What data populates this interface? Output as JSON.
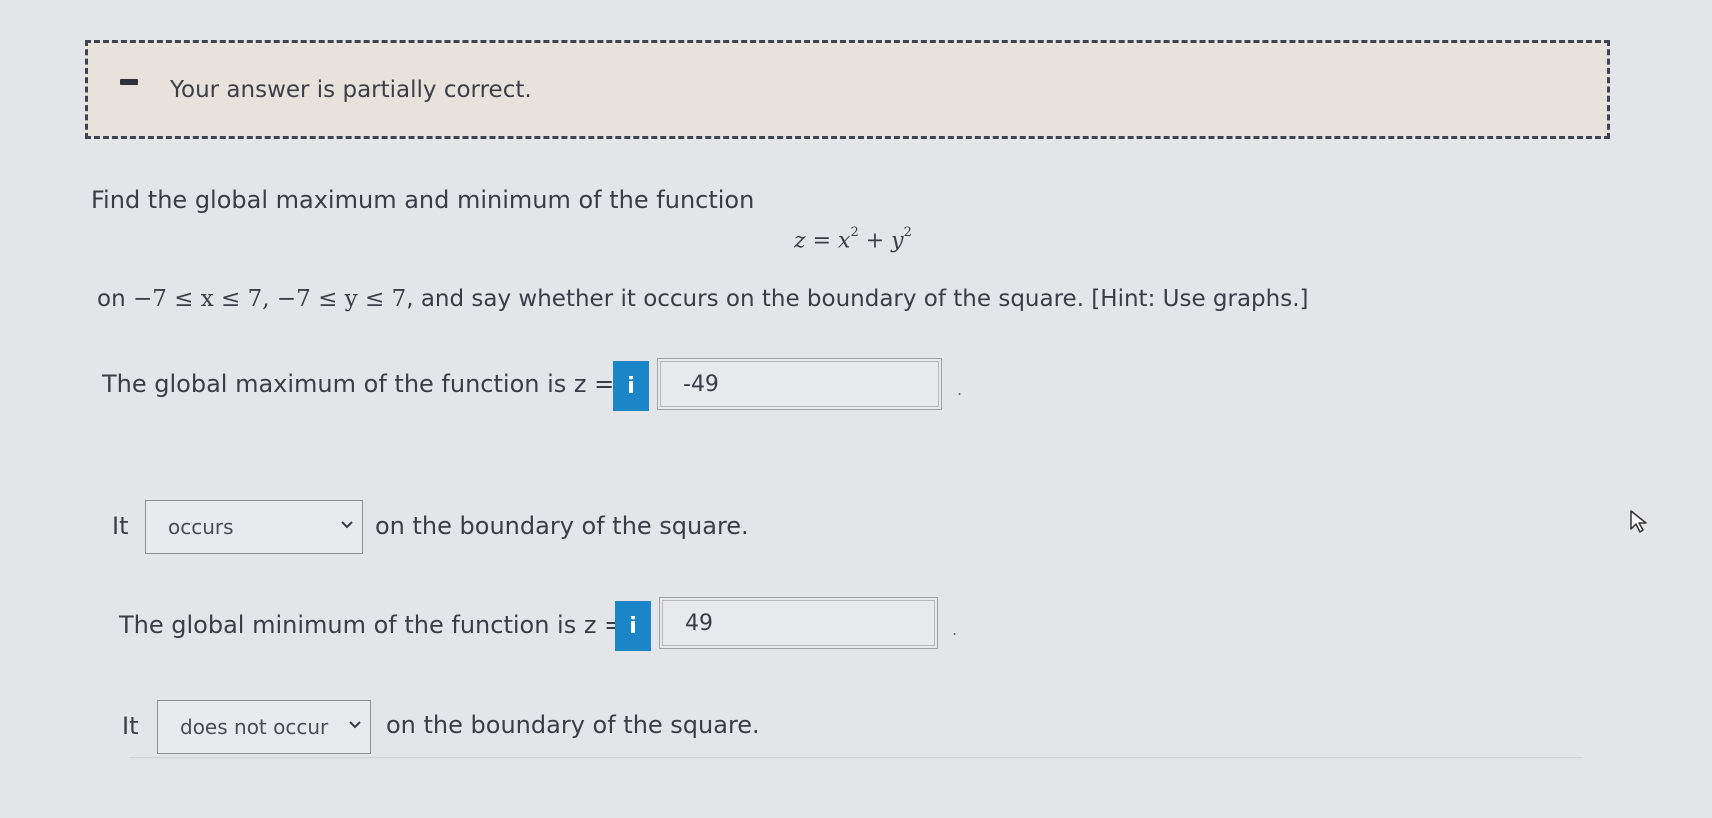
{
  "feedback": {
    "message": "Your answer is partially correct."
  },
  "problem": {
    "prompt": "Find the global maximum and minimum of the function",
    "equation": {
      "lhs": "z",
      "equals": "=",
      "term1": "x",
      "exp1": "2",
      "plus": "+",
      "term2": "y",
      "exp2": "2"
    },
    "constraint_prefix": "on ",
    "constraint_math": "−7 ≤ x ≤ 7, −7 ≤ y ≤ 7",
    "constraint_suffix": ", and say whether it occurs on the boundary of the square. [Hint: Use graphs.]"
  },
  "max": {
    "label": "The global maximum of the function is z =",
    "info_icon": "i",
    "value": "-49",
    "trailing": "."
  },
  "max_boundary": {
    "prefix": "It",
    "selected": "occurs",
    "suffix": "on the boundary of the square."
  },
  "min": {
    "label": "The global minimum of the function is z =",
    "info_icon": "i",
    "value": "49",
    "trailing": "."
  },
  "min_boundary": {
    "prefix": "It",
    "selected": "does not occur",
    "suffix": "on the boundary of the square."
  },
  "colors": {
    "info_blue": "#1a86c8",
    "banner_bg": "#e7e3dc",
    "page_bg": "#e4e5e9"
  }
}
